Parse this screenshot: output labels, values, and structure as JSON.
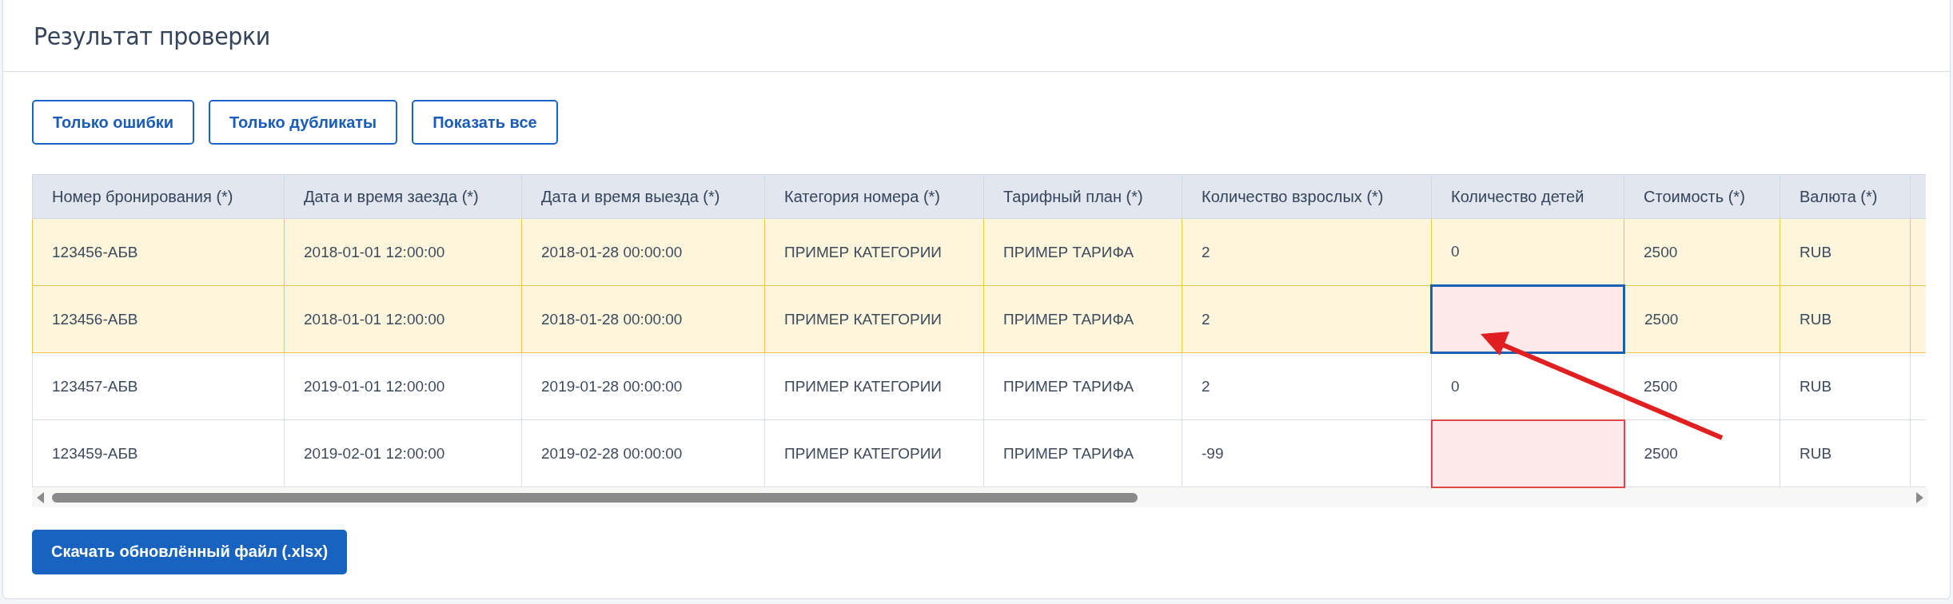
{
  "panel": {
    "title": "Результат проверки"
  },
  "filter_buttons": [
    {
      "label": "Только ошибки"
    },
    {
      "label": "Только дубликаты"
    },
    {
      "label": "Показать все"
    }
  ],
  "table": {
    "columns": [
      "Номер бронирования (*)",
      "Дата и время заезда (*)",
      "Дата и время выезда (*)",
      "Категория номера (*)",
      "Тарифный план (*)",
      "Количество взрослых (*)",
      "Количество детей",
      "Стоимость (*)",
      "Валюта (*)"
    ],
    "rows": [
      {
        "duplicate": true,
        "cells": [
          {
            "text": "123456-АБВ",
            "error": false,
            "selected": false
          },
          {
            "text": "2018-01-01 12:00:00",
            "error": false,
            "selected": false
          },
          {
            "text": "2018-01-28 00:00:00",
            "error": false,
            "selected": false
          },
          {
            "text": "ПРИМЕР КАТЕГОРИИ",
            "error": false,
            "selected": false
          },
          {
            "text": "ПРИМЕР ТАРИФА",
            "error": false,
            "selected": false
          },
          {
            "text": "2",
            "error": false,
            "selected": false
          },
          {
            "text": "0",
            "error": false,
            "selected": false
          },
          {
            "text": "2500",
            "error": false,
            "selected": false
          },
          {
            "text": "RUB",
            "error": false,
            "selected": false
          }
        ]
      },
      {
        "duplicate": true,
        "cells": [
          {
            "text": "123456-АБВ",
            "error": false,
            "selected": false
          },
          {
            "text": "2018-01-01 12:00:00",
            "error": false,
            "selected": false
          },
          {
            "text": "2018-01-28 00:00:00",
            "error": false,
            "selected": false
          },
          {
            "text": "ПРИМЕР КАТЕГОРИИ",
            "error": false,
            "selected": false
          },
          {
            "text": "ПРИМЕР ТАРИФА",
            "error": false,
            "selected": false
          },
          {
            "text": "2",
            "error": false,
            "selected": false
          },
          {
            "error": true,
            "selected": true
          },
          {
            "text": "2500",
            "error": false,
            "selected": false
          },
          {
            "text": "RUB",
            "error": false,
            "selected": false
          }
        ]
      },
      {
        "duplicate": false,
        "cells": [
          {
            "text": "123457-АБВ",
            "error": false,
            "selected": false
          },
          {
            "text": "2019-01-01 12:00:00",
            "error": false,
            "selected": false
          },
          {
            "text": "2019-01-28 00:00:00",
            "error": false,
            "selected": false
          },
          {
            "text": "ПРИМЕР КАТЕГОРИИ",
            "error": false,
            "selected": false
          },
          {
            "text": "ПРИМЕР ТАРИФА",
            "error": false,
            "selected": false
          },
          {
            "text": "2",
            "error": false,
            "selected": false
          },
          {
            "text": "0",
            "error": false,
            "selected": false
          },
          {
            "text": "2500",
            "error": false,
            "selected": false
          },
          {
            "text": "RUB",
            "error": false,
            "selected": false
          }
        ]
      },
      {
        "duplicate": false,
        "cells": [
          {
            "text": "123459-АБВ",
            "error": false,
            "selected": false
          },
          {
            "text": "2019-02-01 12:00:00",
            "error": false,
            "selected": false
          },
          {
            "text": "2019-02-28 00:00:00",
            "error": false,
            "selected": false
          },
          {
            "text": "ПРИМЕР КАТЕГОРИИ",
            "error": false,
            "selected": false
          },
          {
            "text": "ПРИМЕР ТАРИФА",
            "error": false,
            "selected": false
          },
          {
            "text": "-99",
            "error": false,
            "selected": false
          },
          {
            "error": true,
            "selected": false
          },
          {
            "text": "2500",
            "error": false,
            "selected": false
          },
          {
            "text": "RUB",
            "error": false,
            "selected": false
          }
        ]
      }
    ]
  },
  "download_button": {
    "label": "Скачать обновлённый файл (.xlsx)"
  }
}
